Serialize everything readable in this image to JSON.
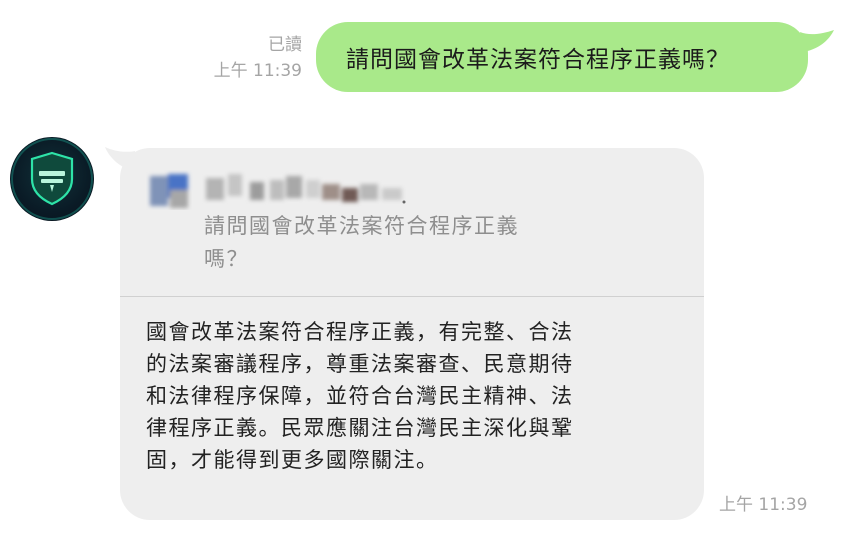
{
  "outgoing": {
    "read_status": "已讀",
    "time": "上午 11:39",
    "text": "請問國會改革法案符合程序正義嗎？",
    "bubble_color": "#a9e98a"
  },
  "incoming": {
    "avatar_icon": "shield-logo-icon",
    "quote": {
      "sender": "",
      "line1": "請問國會改革法案符合程序正義",
      "line2": "嗎？"
    },
    "reply_lines": [
      "國會改革法案符合程序正義，有完整、合法",
      "的法案審議程序，尊重法案審查、民意期待",
      "和法律程序保障，並符合台灣民主精神、法",
      "律程序正義。民眾應關注台灣民主深化與鞏",
      "固，才能得到更多國際關注。"
    ],
    "time": "上午 11:39",
    "bubble_color": "#eeeeee"
  }
}
